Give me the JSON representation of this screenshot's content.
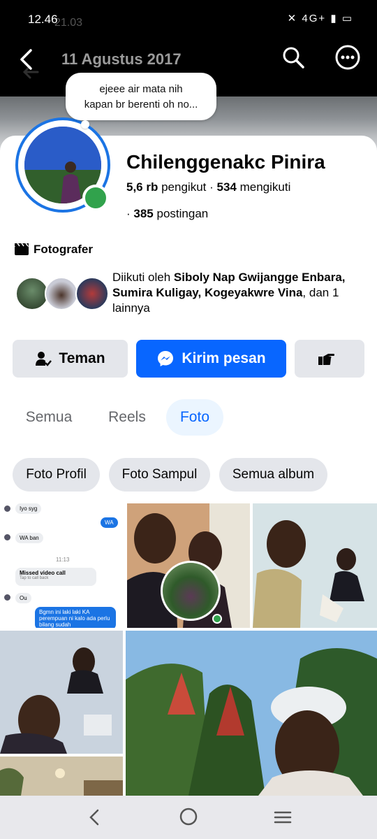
{
  "status_bar": {
    "time": "12.46",
    "ghost_time": "21.03",
    "network": "4G+"
  },
  "top_bar": {
    "title": "11 Agustus 2017"
  },
  "note": {
    "text_line1": "ejeee air mata nih",
    "text_line2": "kapan br berenti oh no..."
  },
  "profile": {
    "name": "Chilenggenakc Pinira",
    "followers_count": "5,6 rb",
    "followers_label": "pengikut",
    "following_count": "534",
    "following_label": "mengikuti",
    "posts_count": "385",
    "posts_label": "postingan",
    "work": "Fotografer",
    "followed_by_prefix": "Diikuti oleh",
    "followed_by_names": "Siboly Nap Gwijangge Enbara, Sumira Kuligay, Kogeyakwre Vina",
    "followed_by_suffix": ", dan 1 lainnya"
  },
  "actions": {
    "friends": "Teman",
    "message": "Kirim pesan"
  },
  "tabs": [
    {
      "label": "Semua"
    },
    {
      "label": "Reels"
    },
    {
      "label": "Foto",
      "active": true
    }
  ],
  "chips": [
    {
      "label": "Foto Profil"
    },
    {
      "label": "Foto Sampul"
    },
    {
      "label": "Semua album"
    }
  ],
  "chat_preview": {
    "msg1": "Iyo syg",
    "msg2": "WA",
    "msg3": "WA ban",
    "time": "11:13",
    "missed_call": "Missed video call",
    "tap_to_call": "Tap to call back",
    "msg4": "Ou",
    "msg5": "Bgmn ini laki laki KA perempuan ni kalo ada perlu bilang sudah"
  },
  "colors": {
    "accent": "#0866ff",
    "online": "#31a24c",
    "chip_bg": "#e4e6eb"
  }
}
